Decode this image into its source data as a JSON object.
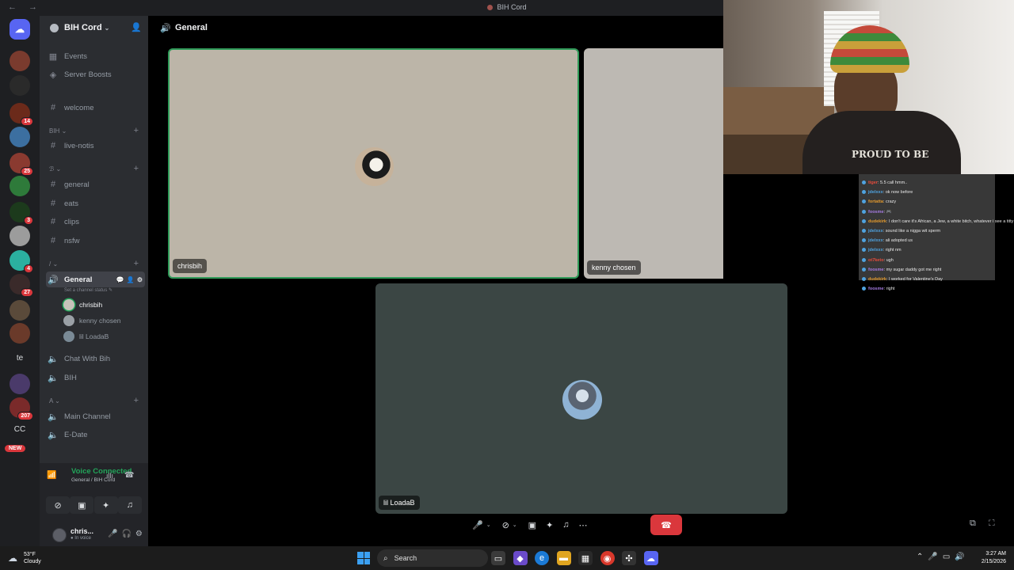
{
  "window": {
    "title": "BIH Cord",
    "nav": "← →"
  },
  "rail": {
    "discord_icon": "discord-logo",
    "servers": [
      {
        "name": "server-1",
        "color": "#7a3b2e",
        "badge": ""
      },
      {
        "name": "server-2",
        "color": "#2a2a2a",
        "badge": ""
      },
      {
        "name": "server-3",
        "color": "#6b2a1a",
        "badge": "14"
      },
      {
        "name": "server-4",
        "color": "#3c6fa0",
        "badge": ""
      },
      {
        "name": "server-5",
        "color": "#8a3a30",
        "badge": "25"
      },
      {
        "name": "server-6",
        "color": "#2e7a3a",
        "badge": ""
      },
      {
        "name": "server-7",
        "color": "#1c3a1c",
        "badge": "3"
      },
      {
        "name": "server-8",
        "color": "#9c9c9c",
        "badge": ""
      },
      {
        "name": "server-9",
        "color": "#2bb0a0",
        "badge": "4"
      },
      {
        "name": "server-10",
        "color": "#3a2a2a",
        "badge": "27"
      },
      {
        "name": "server-11",
        "color": "#5a4a3a",
        "badge": ""
      },
      {
        "name": "server-12",
        "color": "#6a3a2a",
        "badge": ""
      },
      {
        "name": "server-13",
        "color": "#4a3a6a",
        "badge": ""
      },
      {
        "name": "server-14",
        "color": "#7a2a2a",
        "badge": "207"
      }
    ],
    "text_servers": [
      "te",
      "CC"
    ],
    "new_badge": "NEW"
  },
  "sidebar": {
    "guild_name": "BIH Cord",
    "top_items": [
      {
        "label": "Events",
        "icon": "calendar-icon"
      },
      {
        "label": "Server Boosts",
        "icon": "boost-icon"
      }
    ],
    "channels": {
      "welcome": "welcome",
      "cat_bih": "BIH",
      "live_notis": "live-notis",
      "cat_2": "ℬ",
      "general": "general",
      "eats": "eats",
      "clips": "clips",
      "nsfw": "nsfw",
      "cat_3": "/",
      "voice_general": "General",
      "status_placeholder": "Set a channel status",
      "chat_with_bih": "Chat With Bih",
      "bih": "BIH",
      "cat_4": "A",
      "main_channel": "Main Channel",
      "e_date": "E-Date"
    },
    "voice_users": [
      {
        "name": "chrisbih",
        "speaking": true
      },
      {
        "name": "kenny chosen",
        "speaking": false
      },
      {
        "name": "lil LoadaB",
        "speaking": false
      }
    ]
  },
  "voice_panel": {
    "title": "Voice Connected",
    "subtitle": "General / BIH Cord"
  },
  "user_panel": {
    "name": "chris...",
    "status": "In voice"
  },
  "stage": {
    "channel_name": "General",
    "tiles": [
      {
        "name": "chrisbih"
      },
      {
        "name": "kenny chosen"
      },
      {
        "name": "lil LoadaB"
      }
    ]
  },
  "cam": {
    "shirt_text": "PROUD TO BE"
  },
  "chat": [
    {
      "user": "tiger",
      "text": ": 5.5 call hmm..",
      "color": "#e74c3c"
    },
    {
      "user": "jdelxxx",
      "text": ": ok now before",
      "color": "#4fa3e0"
    },
    {
      "user": "fortatta",
      "text": ": crazy",
      "color": "#e39a2d"
    },
    {
      "user": "foosme",
      "text": ": 🎮",
      "color": "#a57be0"
    },
    {
      "user": "dudekirk",
      "text": ": I don't care it's African, a Jew, a white bitch, whatever i see a titty in my mouth",
      "color": "#e39a2d"
    },
    {
      "user": "jdelxxx",
      "text": ": sound like a nigga wit sperm",
      "color": "#4fa3e0"
    },
    {
      "user": "jdelxxx",
      "text": ": ali adopted us",
      "color": "#4fa3e0"
    },
    {
      "user": "jdelxxx",
      "text": ": right nm",
      "color": "#4fa3e0"
    },
    {
      "user": "ot7keto",
      "text": ": ugh",
      "color": "#e74c3c"
    },
    {
      "user": "foosme",
      "text": ": my sugar daddy got me right",
      "color": "#a57be0"
    },
    {
      "user": "dudekirk",
      "text": ": I worked for Valentine's Day",
      "color": "#e39a2d"
    },
    {
      "user": "foosme",
      "text": ": right",
      "color": "#a57be0"
    }
  ],
  "taskbar": {
    "temp": "53°F",
    "condition": "Cloudy",
    "search": "Search",
    "time": "3:27 AM",
    "date": "2/15/2026"
  }
}
